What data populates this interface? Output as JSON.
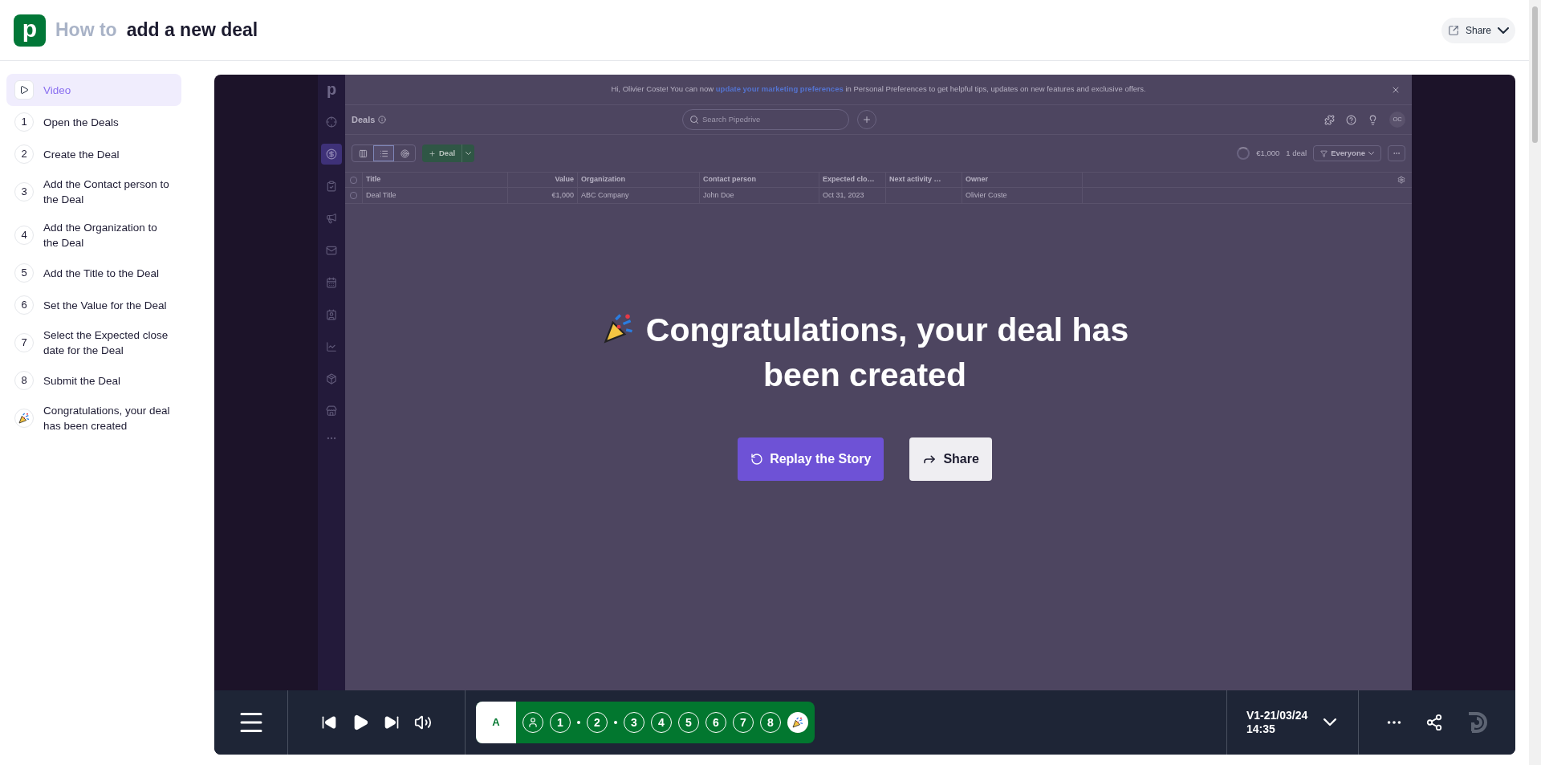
{
  "header": {
    "logo_letter": "p",
    "title_prefix": "How to",
    "title": "add a new deal",
    "share_button": "Share"
  },
  "sidebar": {
    "items": [
      {
        "kind": "video",
        "label": "Video",
        "selected": true
      },
      {
        "kind": "step",
        "number": "1",
        "label": "Open the Deals",
        "selected": false
      },
      {
        "kind": "step",
        "number": "2",
        "label": "Create the Deal",
        "selected": false
      },
      {
        "kind": "step",
        "number": "3",
        "label": "Add the Contact person to the Deal",
        "selected": false
      },
      {
        "kind": "step",
        "number": "4",
        "label": "Add the Organization to the Deal",
        "selected": false
      },
      {
        "kind": "step",
        "number": "5",
        "label": "Add the Title to the Deal",
        "selected": false
      },
      {
        "kind": "step",
        "number": "6",
        "label": "Set the Value for the Deal",
        "selected": false
      },
      {
        "kind": "step",
        "number": "7",
        "label": "Select the Expected close date for the Deal",
        "selected": false
      },
      {
        "kind": "step",
        "number": "8",
        "label": "Submit the Deal",
        "selected": false
      },
      {
        "kind": "celebration",
        "label": "Congratulations, your deal has been created",
        "selected": false
      }
    ]
  },
  "player": {
    "app": {
      "logo_letter": "p",
      "nav_items": [
        {
          "selected": false
        },
        {
          "selected": true
        },
        {
          "selected": false
        },
        {
          "selected": false
        },
        {
          "selected": false
        },
        {
          "selected": false
        },
        {
          "selected": false
        },
        {
          "selected": false
        },
        {
          "selected": false
        },
        {
          "selected": false
        }
      ],
      "banner": {
        "before": "Hi, Olivier Coste! You can now",
        "link": "update your marketing preferences",
        "after": "in Personal Preferences to get helpful tips, updates on new features and exclusive offers."
      },
      "page_title": "Deals",
      "search": {
        "placeholder": "Search Pipedrive"
      },
      "avatar": "OC",
      "add_button": "Deal",
      "total": "€1,000",
      "count": "1 deal",
      "filter": "Everyone",
      "select_all_checked": false,
      "columns": [
        "Title",
        "Value",
        "Organization",
        "Contact person",
        "Expected clo…",
        "Next activity …",
        "Owner"
      ],
      "rows": [
        {
          "checked": false,
          "cells": [
            "Deal Title",
            "€1,000",
            "ABC Company",
            "John Doe",
            "Oct 31, 2023",
            "",
            "Olivier Coste"
          ]
        }
      ]
    },
    "end_screen": {
      "title": "Congratulations, your deal has been created",
      "replay_button": "Replay the Story",
      "share_button": "Share"
    },
    "controls": {
      "chapter": "A",
      "steps": [
        {
          "kind": "person"
        },
        {
          "kind": "number",
          "label": "1"
        },
        {
          "kind": "dot"
        },
        {
          "kind": "number",
          "label": "2"
        },
        {
          "kind": "dot"
        },
        {
          "kind": "number",
          "label": "3"
        },
        {
          "kind": "number",
          "label": "4"
        },
        {
          "kind": "number",
          "label": "5"
        },
        {
          "kind": "number",
          "label": "6"
        },
        {
          "kind": "number",
          "label": "7"
        },
        {
          "kind": "number",
          "label": "8"
        },
        {
          "kind": "celebration"
        }
      ],
      "version_lines": [
        "V1-21/03/24",
        "14:35"
      ]
    }
  }
}
